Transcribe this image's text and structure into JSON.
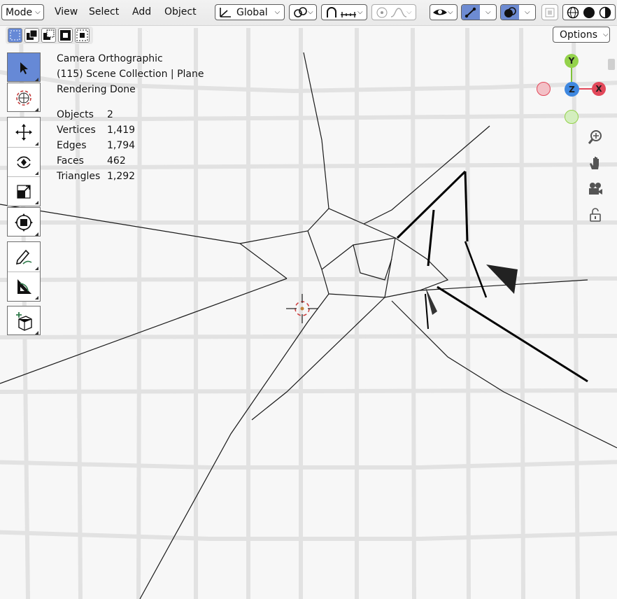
{
  "header": {
    "mode_label": "Mode",
    "menu": [
      "View",
      "Select",
      "Add",
      "Object"
    ],
    "orientation": "Global",
    "options_label": "Options"
  },
  "overlay": {
    "view_name": "Camera Orthographic",
    "collection": "(115) Scene Collection | Plane",
    "status": "Rendering Done",
    "stats": [
      {
        "label": "Objects",
        "value": "2"
      },
      {
        "label": "Vertices",
        "value": "1,419"
      },
      {
        "label": "Edges",
        "value": "1,794"
      },
      {
        "label": "Faces",
        "value": "462"
      },
      {
        "label": "Triangles",
        "value": "1,292"
      }
    ]
  },
  "gizmo": {
    "y": "Y",
    "z": "Z",
    "x": "X"
  },
  "tools": [
    "select-box",
    "cursor",
    "move",
    "rotate",
    "scale",
    "transform",
    "annotate",
    "measure",
    "add-cube"
  ],
  "colors": {
    "accent": "#6689d6",
    "axis_x": "#e2485a",
    "axis_y": "#7fc23a",
    "axis_z": "#3f88e0"
  }
}
